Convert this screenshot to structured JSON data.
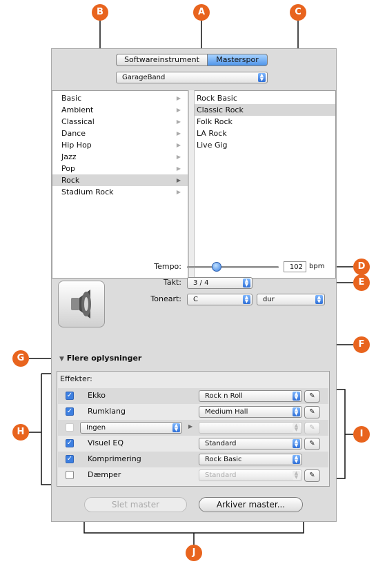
{
  "tabs": [
    {
      "label": "Softwareinstrument",
      "selected": false
    },
    {
      "label": "Masterspor",
      "selected": true
    }
  ],
  "library_popup": {
    "value": "GarageBand"
  },
  "categories": [
    {
      "label": "Basic"
    },
    {
      "label": "Ambient"
    },
    {
      "label": "Classical"
    },
    {
      "label": "Dance"
    },
    {
      "label": "Hip Hop"
    },
    {
      "label": "Jazz"
    },
    {
      "label": "Pop"
    },
    {
      "label": "Rock",
      "selected": true
    },
    {
      "label": "Stadium Rock"
    }
  ],
  "presets": [
    {
      "label": "Rock Basic"
    },
    {
      "label": "Classic Rock",
      "selected": true
    },
    {
      "label": "Folk Rock"
    },
    {
      "label": "LA Rock"
    },
    {
      "label": "Live Gig"
    }
  ],
  "tempo": {
    "label": "Tempo:",
    "value": "102",
    "unit": "bpm",
    "slider_fraction": 0.17
  },
  "takt": {
    "label": "Takt:",
    "value": "3 / 4"
  },
  "toneart": {
    "label": "Toneart:",
    "key": "C",
    "mode": "dur"
  },
  "details_toggle": {
    "label": "Flere oplysninger"
  },
  "effects": {
    "label": "Effekter:",
    "rows": [
      {
        "name": "Ekko",
        "checked": true,
        "preset": "Rock n Roll",
        "editable": true
      },
      {
        "name": "Rumklang",
        "checked": true,
        "preset": "Medium Hall",
        "editable": true
      },
      {
        "name": "Ingen",
        "checked": false,
        "preset": "",
        "editable": false,
        "is_slot": true
      },
      {
        "name": "Visuel EQ",
        "checked": true,
        "preset": "Standard",
        "editable": true
      },
      {
        "name": "Komprimering",
        "checked": true,
        "preset": "Rock Basic",
        "editable": false,
        "no_edit_button": true
      },
      {
        "name": "Dæmper",
        "checked": false,
        "preset": "Standard",
        "editable": true,
        "preset_disabled": true
      }
    ]
  },
  "buttons": {
    "delete": "Slet master",
    "save": "Arkiver master..."
  },
  "callouts": [
    "A",
    "B",
    "C",
    "D",
    "E",
    "F",
    "G",
    "H",
    "I",
    "J"
  ],
  "colors": {
    "callout": "#e8641e",
    "selection": "#d7d7d7",
    "accent_blue": "#3d7fe0"
  },
  "icons": {
    "instrument": "speaker-icon",
    "edit": "pencil-icon",
    "disclosure": "triangle-down-icon"
  }
}
